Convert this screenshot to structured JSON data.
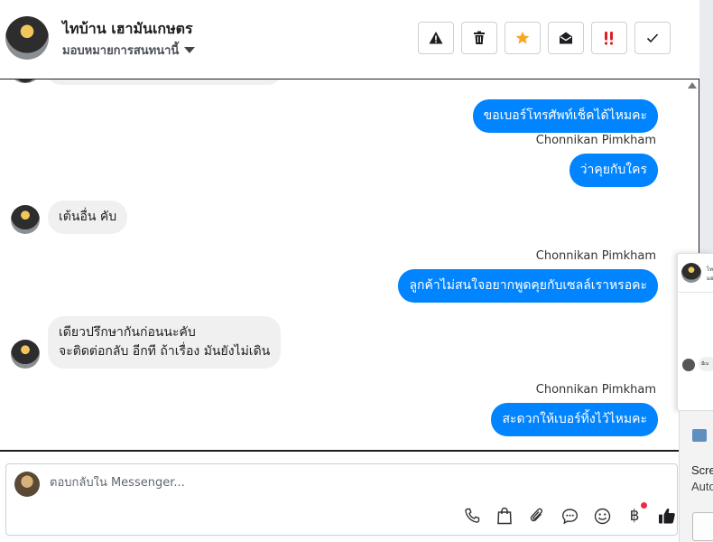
{
  "header": {
    "contact_name": "ไทบ้าน เฮามันเกษตร",
    "assign_label": "มอบหมายการสนทนานี้",
    "actions": [
      {
        "name": "warning-button",
        "icon": "warning-icon"
      },
      {
        "name": "delete-button",
        "icon": "trash-icon"
      },
      {
        "name": "star-button",
        "icon": "star-icon"
      },
      {
        "name": "mark-unread-button",
        "icon": "envelope-open-icon"
      },
      {
        "name": "priority-button",
        "icon": "double-exclamation-icon"
      },
      {
        "name": "mark-done-button",
        "icon": "checkmark-icon"
      }
    ]
  },
  "messages": [
    {
      "direction": "out",
      "text": "ขอเบอร์โทรศัพท์เช็คได้ไหมคะ"
    },
    {
      "direction": "out",
      "sender": "Chonnikan Pimkham",
      "text": "ว่าคุยกับใคร"
    },
    {
      "direction": "in",
      "text": "เต้นอื่น คับ"
    },
    {
      "direction": "out",
      "sender": "Chonnikan Pimkham",
      "text": "ลูกค้าไม่สนใจอยากพูดคุยกับเซลล์เราหรอคะ"
    },
    {
      "direction": "in",
      "lines": [
        "เดียวปรึกษากันก่อนนะคับ",
        "จะติดต่อกลับ อีกที ถ้าเรื่อง มันยังไม่เดิน"
      ]
    },
    {
      "direction": "out",
      "sender": "Chonnikan Pimkham",
      "text": "สะดวกให้เบอร์ทิ้งไว้ไหมคะ"
    }
  ],
  "composer": {
    "placeholder": "ตอบกลับใน Messenger...",
    "tools": [
      "phone-icon",
      "shopping-bag-icon",
      "paperclip-icon",
      "saved-reply-icon",
      "emoji-icon",
      "baht-icon",
      "like-icon"
    ],
    "baht_symbol": "฿"
  },
  "popup": {
    "name_fragment": "ไท",
    "sub_fragment": "มอ",
    "bubble_fragment": "มีเบ"
  },
  "notification": {
    "title": "Scre",
    "subtitle": "Auto"
  },
  "colors": {
    "outgoing_bubble": "#0084ff",
    "incoming_bubble": "#f1f0f0",
    "star": "#f5a623",
    "priority": "#e02020"
  }
}
